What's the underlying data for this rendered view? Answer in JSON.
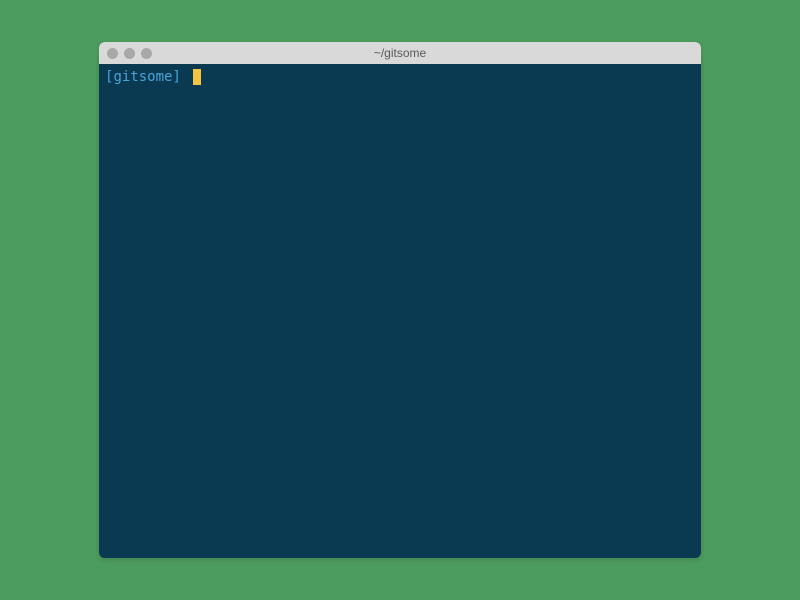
{
  "window": {
    "title": "~/gitsome"
  },
  "terminal": {
    "prompt_open": "[",
    "prompt_name": "gitsome",
    "prompt_close": "]",
    "input_value": ""
  }
}
